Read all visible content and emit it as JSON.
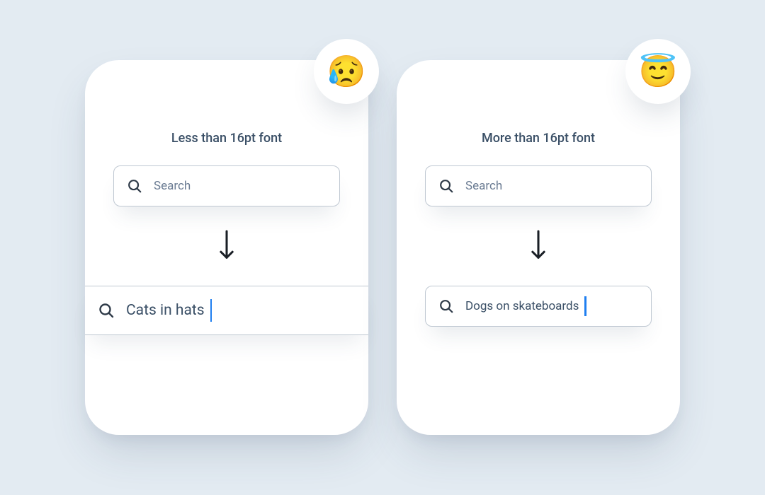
{
  "left_card": {
    "badge_emoji": "😥",
    "title": "Less than 16pt font",
    "search_placeholder": "Search",
    "result_text": "Cats in hats"
  },
  "right_card": {
    "badge_emoji": "😇",
    "title": "More than 16pt font",
    "search_placeholder": "Search",
    "result_text": "Dogs on skateboards"
  }
}
